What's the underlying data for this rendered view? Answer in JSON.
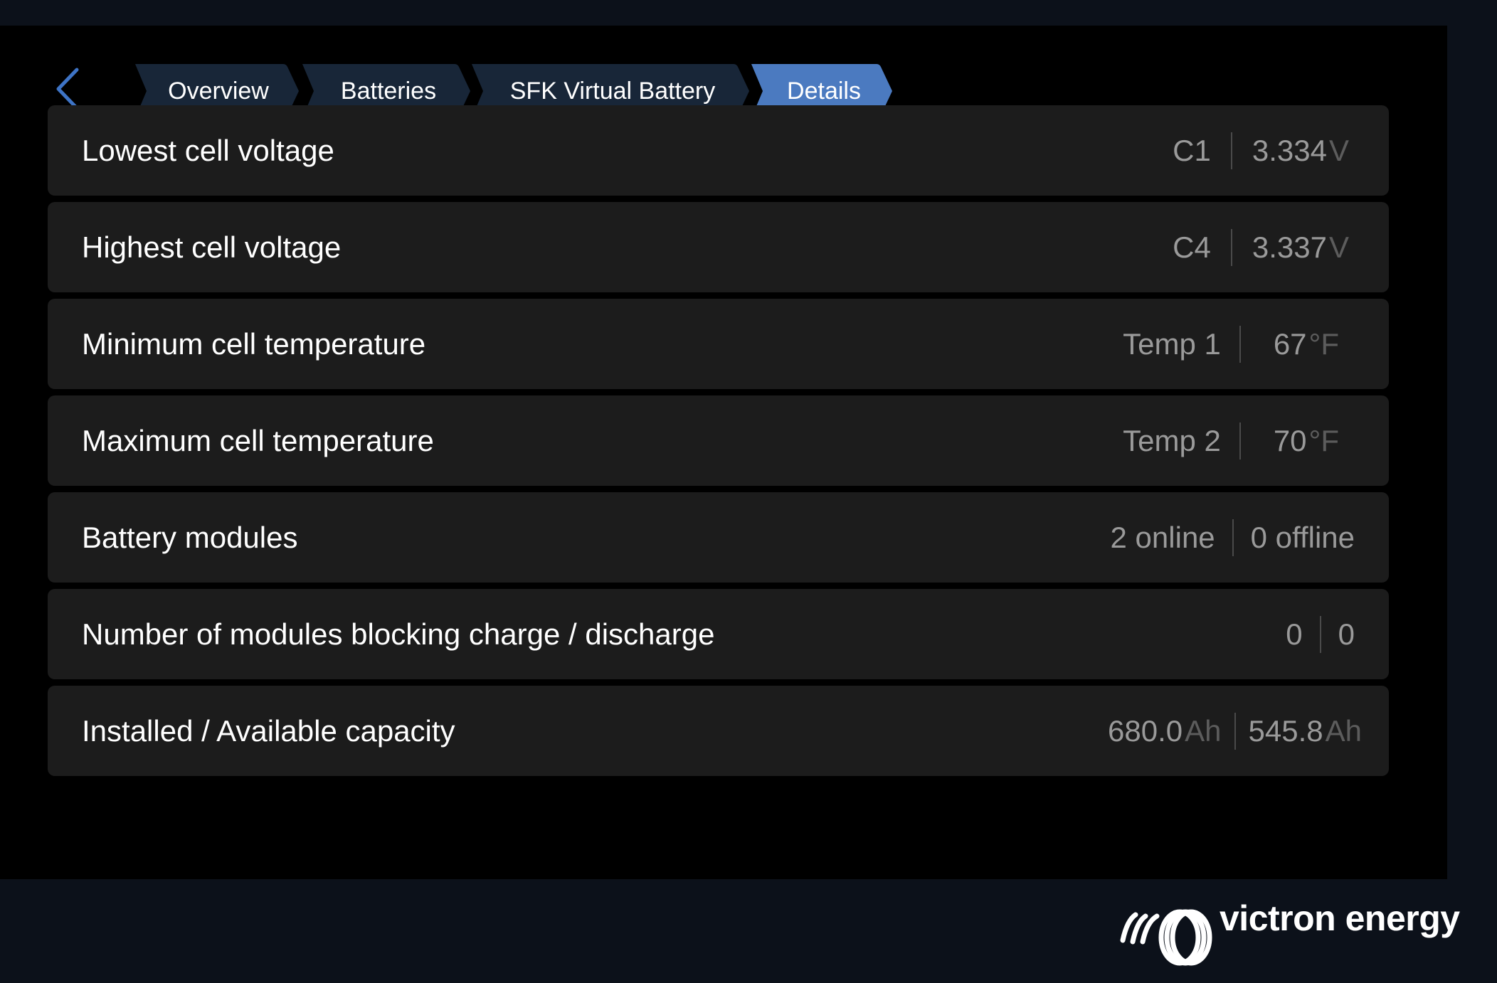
{
  "breadcrumb": {
    "items": [
      {
        "label": "Overview"
      },
      {
        "label": "Batteries"
      },
      {
        "label": "SFK Virtual Battery"
      },
      {
        "label": "Details",
        "active": true
      }
    ]
  },
  "rows": [
    {
      "label": "Lowest cell voltage",
      "left": "C1",
      "right_value": "3.334",
      "right_unit": "V"
    },
    {
      "label": "Highest cell voltage",
      "left": "C4",
      "right_value": "3.337",
      "right_unit": "V"
    },
    {
      "label": "Minimum cell temperature",
      "left": "Temp 1",
      "right_value": "67",
      "right_unit": "°F"
    },
    {
      "label": "Maximum cell temperature",
      "left": "Temp 2",
      "right_value": "70",
      "right_unit": "°F"
    },
    {
      "label": "Battery modules",
      "left": "2 online",
      "right_value": "0 offline"
    },
    {
      "label": "Number of modules blocking charge / discharge",
      "left": "0",
      "right_value": "0"
    },
    {
      "label": "Installed / Available capacity",
      "left": "680.0",
      "left_unit": "Ah",
      "right_value": "545.8",
      "right_unit": "Ah"
    }
  ],
  "brand": {
    "name": "victron energy"
  },
  "colors": {
    "background": "#000000",
    "frame": "#0c111a",
    "crumb": "#182638",
    "crumb_active": "#4b7ac0",
    "row": "#1c1c1c",
    "accent": "#3e74c6"
  }
}
